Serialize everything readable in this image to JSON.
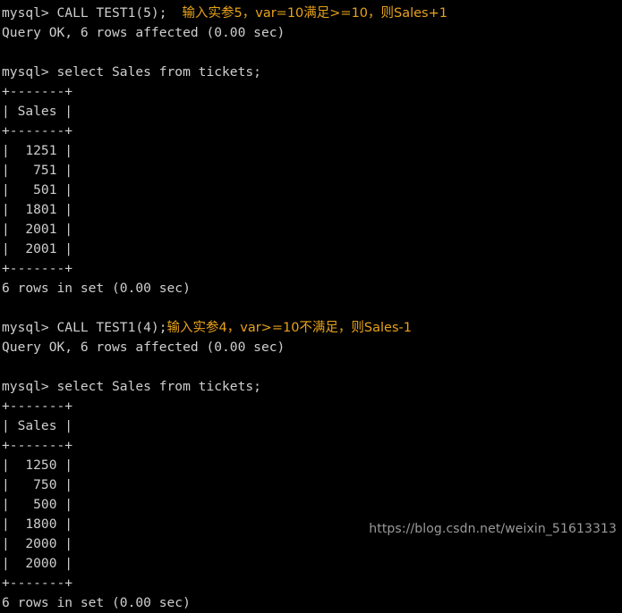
{
  "terminal": {
    "background_color": "#000000",
    "text_color": "#cfcfcf",
    "annotation_color": "#e8a21b",
    "watermark_color": "#9a9a9a",
    "blocks": [
      {
        "command_prompt": "mysql> CALL TEST1(5);",
        "annotation": "输入实参5，var=10满足>=10，则Sales+1",
        "result_line": "Query OK, 6 rows affected (0.00 sec)"
      },
      {
        "command_prompt": "mysql> select Sales from tickets;",
        "table": {
          "top_border": "+-------+",
          "header_row": "| Sales |",
          "header_border": "+-------+",
          "rows": [
            "|  1251 |",
            "|   751 |",
            "|   501 |",
            "|  1801 |",
            "|  2001 |",
            "|  2001 |"
          ],
          "bottom_border": "+-------+"
        },
        "result_line": "6 rows in set (0.00 sec)"
      },
      {
        "command_prompt": "mysql> CALL TEST1(4);",
        "annotation": "输入实参4，var>=10不满足，则Sales-1",
        "result_line": "Query OK, 6 rows affected (0.00 sec)"
      },
      {
        "command_prompt": "mysql> select Sales from tickets;",
        "table": {
          "top_border": "+-------+",
          "header_row": "| Sales |",
          "header_border": "+-------+",
          "rows": [
            "|  1250 |",
            "|   750 |",
            "|   500 |",
            "|  1800 |",
            "|  2000 |",
            "|  2000 |"
          ],
          "bottom_border": "+-------+"
        },
        "result_line": "6 rows in set (0.00 sec)"
      }
    ],
    "watermark": "https://blog.csdn.net/weixin_51613313"
  }
}
